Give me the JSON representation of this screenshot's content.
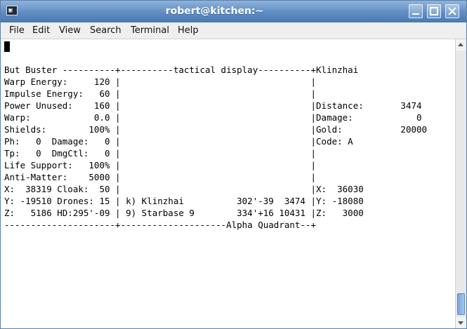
{
  "window": {
    "title": "robert@kitchen:~",
    "icon": "terminal-icon",
    "icon_glyph": "▣"
  },
  "menubar": {
    "items": [
      {
        "label": "File"
      },
      {
        "label": "Edit"
      },
      {
        "label": "View"
      },
      {
        "label": "Search"
      },
      {
        "label": "Terminal"
      },
      {
        "label": "Help"
      }
    ]
  },
  "terminal": {
    "lines": [
      "But Buster ----------+----------tactical display----------+Klinzhai",
      "Warp Energy:     120 |                                    |",
      "Impulse Energy:   60 |                                    |",
      "Power Unused:    160 |                                    |Distance:       3474",
      "Warp:            0.0 |                                    |Damage:            0",
      "Shields:        100% |                                    |Gold:           20000",
      "Ph:   0  Damage:   0 |                                    |Code: A",
      "Tp:   0  DmgCtl:   0 |                                    |",
      "Life Support:   100% |                                    |",
      "Anti-Matter:    5000 |                                    |",
      "X:  38319 Cloak:  50 |                                    |X:  36030",
      "Y: -19510 Drones: 15 | k) Klinzhai          302'-39  3474 |Y: -18080",
      "Z:   5186 HD:295'-09 | 9) Starbase 9        334'+16 10431 |Z:   3000",
      "---------------------+--------------------Alpha Quadrant--+"
    ]
  },
  "colors": {
    "titlebar": "#5f8cc2",
    "terminal_bg": "#ffffff",
    "terminal_fg": "#000000"
  }
}
